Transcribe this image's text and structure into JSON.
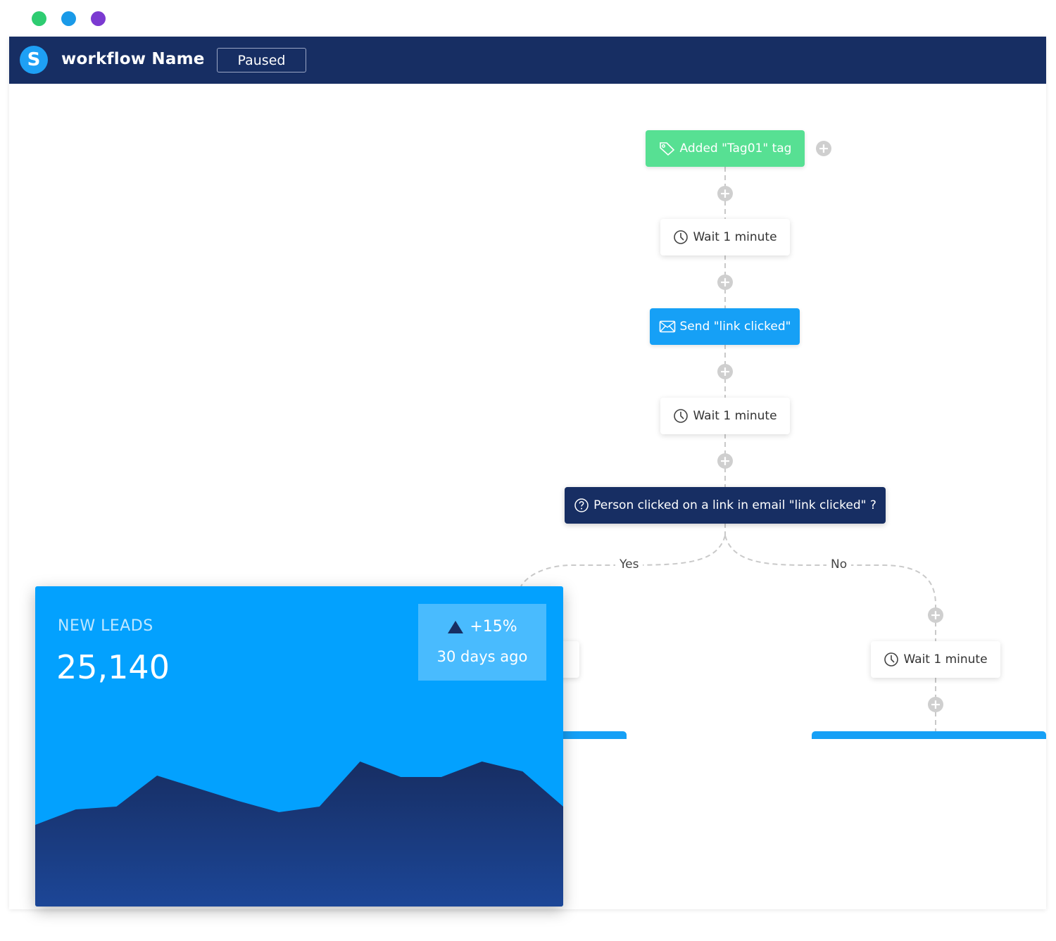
{
  "window": {
    "traffic_lights": [
      {
        "name": "green",
        "color": "#2ecc71"
      },
      {
        "name": "blue",
        "color": "#1a9ae8"
      },
      {
        "name": "purple",
        "color": "#7b3ad1"
      }
    ]
  },
  "topbar": {
    "logo_letter": "S",
    "workflow_name": "workflow Name",
    "status": "Paused",
    "background": "#172e63"
  },
  "workflow": {
    "trigger": {
      "label": "Added \"Tag01\" tag",
      "icon": "tag-icon",
      "color": "#57e093"
    },
    "wait_1": {
      "label": "Wait 1 minute",
      "icon": "clock-icon"
    },
    "send_email": {
      "label": "Send \"link clicked\"",
      "icon": "envelope-icon",
      "color": "#16a0f6"
    },
    "wait_2": {
      "label": "Wait 1 minute",
      "icon": "clock-icon"
    },
    "condition": {
      "label": "Person clicked on a link in email \"link clicked\" ?",
      "icon": "question-circle-icon",
      "color": "#172e63"
    },
    "branch_yes": {
      "label": "Yes"
    },
    "branch_no": {
      "label": "No"
    },
    "no_wait": {
      "label": "Wait 1 minute",
      "icon": "clock-icon"
    }
  },
  "stats_card": {
    "label": "NEW LEADS",
    "value": "25,140",
    "delta": "+15%",
    "delta_period": "30 days ago",
    "background": "#03a1fe",
    "chart_data": {
      "type": "area",
      "x": [
        0,
        1,
        2,
        3,
        4,
        5,
        6,
        7,
        8,
        9,
        10,
        11,
        12,
        13
      ],
      "values": [
        58,
        69,
        71,
        93,
        84,
        75,
        67,
        71,
        103,
        92,
        92,
        103,
        96,
        71
      ],
      "ylim": [
        0,
        160
      ],
      "grid": false,
      "legend": "none",
      "colors": {
        "area_top": "#172e63",
        "area_bottom": "#1c4697"
      }
    }
  }
}
